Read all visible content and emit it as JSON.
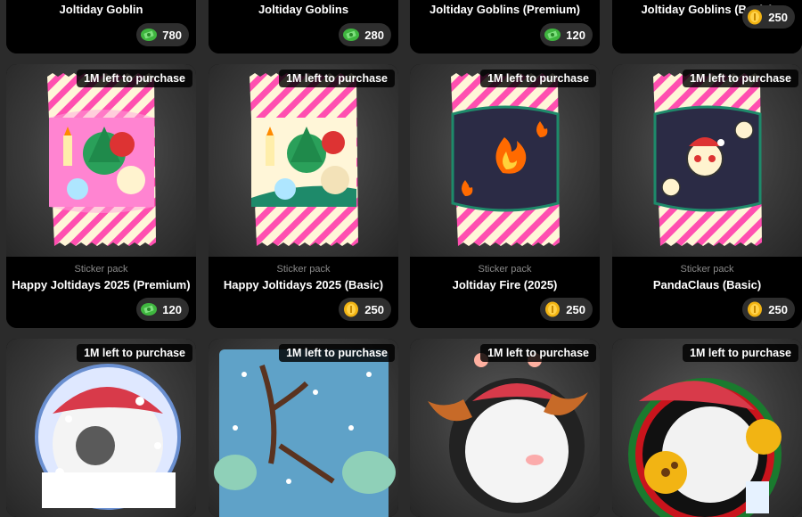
{
  "badge_text": "1M left to purchase",
  "top_row": [
    {
      "title": "Joltiday Goblin",
      "price": "780",
      "currency_icon": "cash-icon"
    },
    {
      "title": "Joltiday Goblins",
      "price": "280",
      "currency_icon": "cash-icon"
    },
    {
      "title": "Joltiday Goblins (Premium)",
      "price": "120",
      "currency_icon": "cash-icon"
    },
    {
      "title": "Joltiday Goblins (Basic)",
      "price": "250",
      "currency_icon": "coin-icon"
    }
  ],
  "mid_row": [
    {
      "type": "Sticker pack",
      "title": "Happy Joltidays 2025 (Premium)",
      "price": "120",
      "currency_icon": "cash-icon"
    },
    {
      "type": "Sticker pack",
      "title": "Happy Joltidays 2025 (Basic)",
      "price": "250",
      "currency_icon": "coin-icon"
    },
    {
      "type": "Sticker pack",
      "title": "Joltiday Fire (2025)",
      "price": "250",
      "currency_icon": "coin-icon"
    },
    {
      "type": "Sticker pack",
      "title": "PandaClaus (Basic)",
      "price": "250",
      "currency_icon": "coin-icon"
    }
  ],
  "colors": {
    "cash": "#3fb63f",
    "coin": "#f2b413",
    "pack_pink": "#ff4fb0",
    "pack_cream": "#fff6d8"
  }
}
